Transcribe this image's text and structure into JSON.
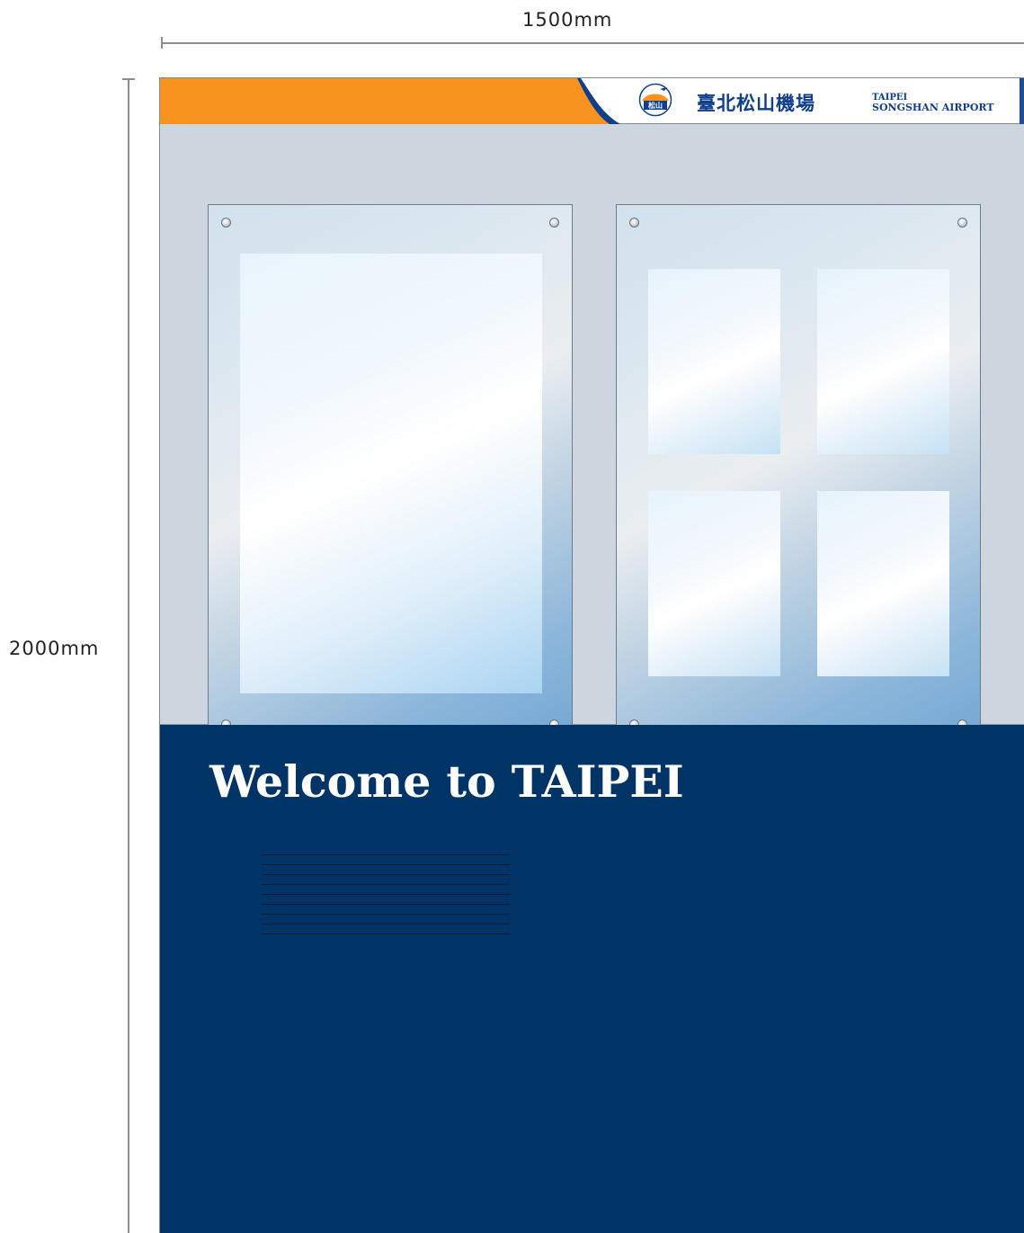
{
  "dimensions": {
    "width_label": "1500mm",
    "height_label": "2000mm"
  },
  "header": {
    "chinese_name": "臺北松山機場",
    "english_line1": "TAIPEI",
    "english_line2": "SONGSHAN AIRPORT",
    "emblem_text": "松山",
    "colors": {
      "orange": "#f7931e",
      "logo_blue": "#0f3f8c"
    }
  },
  "panels": {
    "left_frame": {
      "posters": 1
    },
    "right_frame": {
      "posters": 4
    }
  },
  "footer": {
    "welcome_text": "Welcome to TAIPEI",
    "colors": {
      "navy": "#003366"
    }
  }
}
